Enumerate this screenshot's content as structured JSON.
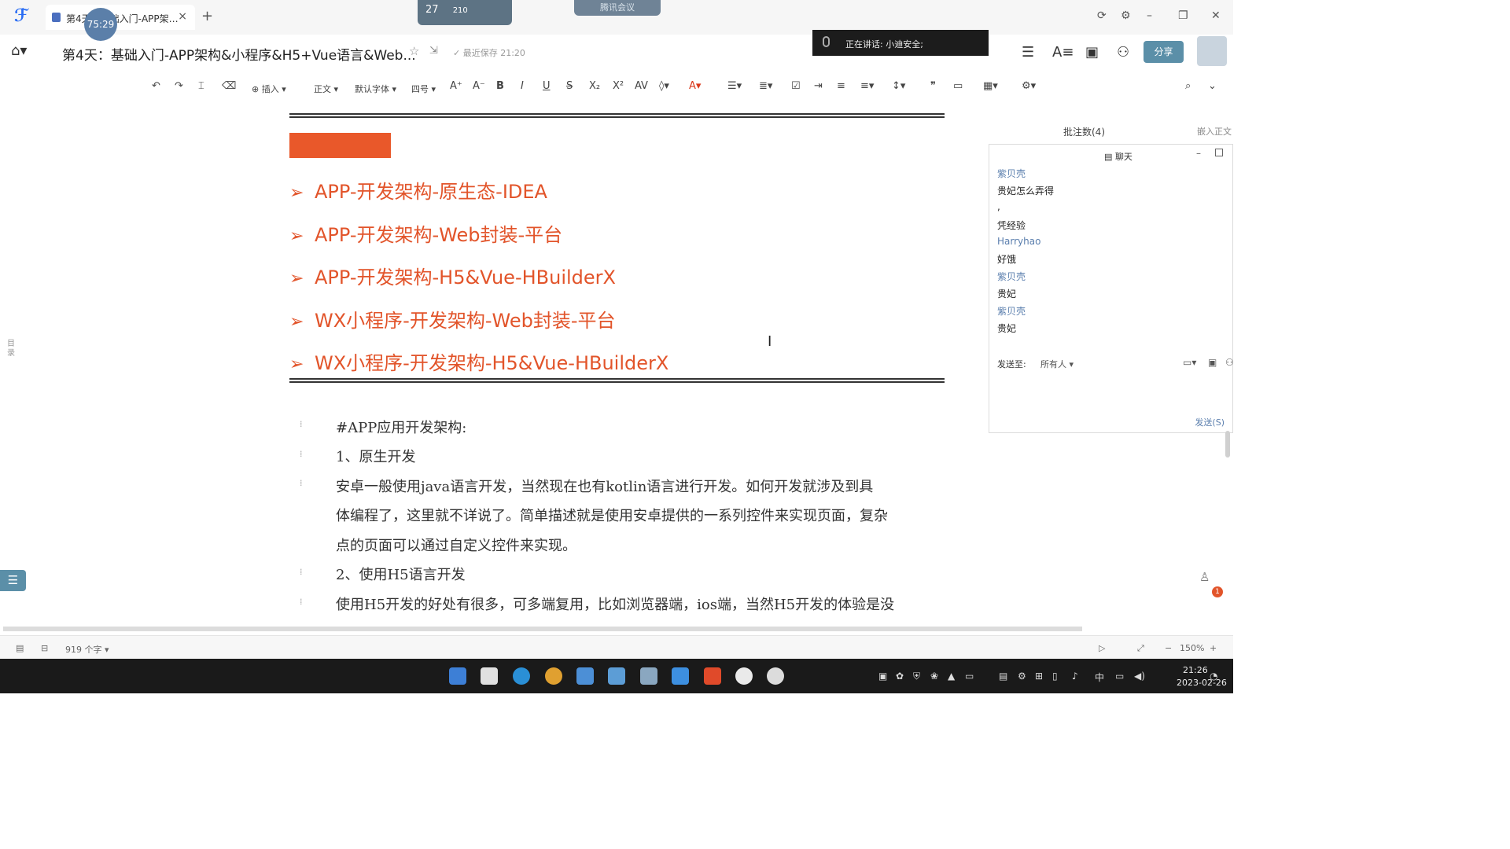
{
  "tab": {
    "label": "第4天：基础入门-APP架…",
    "close": "×",
    "new": "+",
    "timer": "75:29"
  },
  "weather": {
    "temp": "27",
    "extra": "210"
  },
  "meeting": {
    "label": "腾讯会议"
  },
  "window": {
    "restore": "⟳",
    "settings": "⚙",
    "min": "–",
    "max": "❐",
    "close": "✕"
  },
  "titlebar": {
    "title": "第4天：基础入门-APP架构&小程序&H5+Vue语言&Web...",
    "saved": "最近保存 21:20",
    "speaking": "正在讲话: 小迪安全;",
    "share": "分享"
  },
  "toolbar": {
    "insert": "插入",
    "style": "正文",
    "font": "默认字体",
    "size": "四号"
  },
  "doc": {
    "bullets": [
      "APP-开发架构-原生态-IDEA",
      "APP-开发架构-Web封装-平台",
      "APP-开发架构-H5&Vue-HBuilderX",
      "WX小程序-开发架构-Web封装-平台",
      "WX小程序-开发架构-H5&Vue-HBuilderX"
    ],
    "lines": [
      "#APP应用开发架构:",
      "1、原生开发",
      "安卓一般使用java语言开发，当然现在也有kotlin语言进行开发。如何开发就涉及到具",
      "体编程了，这里就不详说了。简单描述就是使用安卓提供的一系列控件来实现页面，复杂",
      "点的页面可以通过自定义控件来实现。",
      "2、使用H5语言开发",
      "使用H5开发的好处有很多，可多端复用，比如浏览器端，ios端，当然H5开发的体验是没"
    ]
  },
  "comments": {
    "label": "批注数(4)",
    "embed": "嵌入正文"
  },
  "chat": {
    "title": "聊天",
    "messages": [
      {
        "name": "紫贝壳",
        "text": "贵妃怎么弄得"
      },
      {
        "name": ",",
        "text": "凭经验"
      },
      {
        "name": "Harryhao",
        "text": "好饿"
      },
      {
        "name": "紫贝壳",
        "text": "贵妃"
      },
      {
        "name": "紫贝壳",
        "text": "贵妃"
      }
    ],
    "send_to_label": "发送至:",
    "send_target": "所有人",
    "send_button": "发送(S)"
  },
  "sidebar": {
    "outline": "目录"
  },
  "notification_count": "1",
  "statusbar": {
    "word_count": "919 个字",
    "zoom": "150%"
  },
  "clock": {
    "time": "21:26",
    "date": "2023-02-26"
  },
  "tray": {
    "ime": "中"
  }
}
